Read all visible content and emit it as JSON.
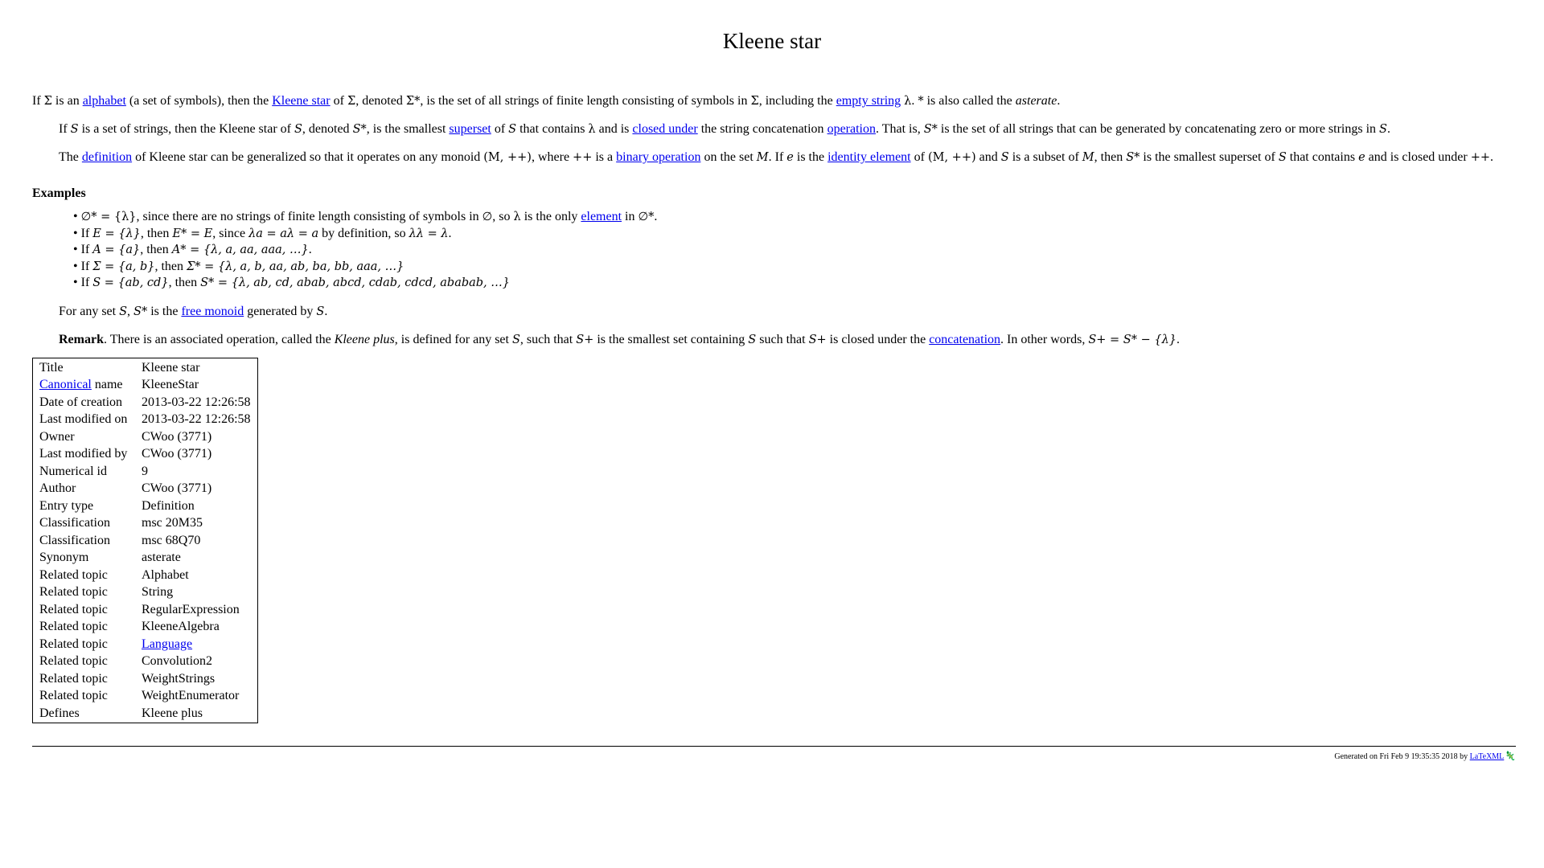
{
  "title": "Kleene star",
  "intro": {
    "t1": "If ",
    "sigma": "Σ",
    "t2": " is an ",
    "link_alphabet": "alphabet",
    "t3": " (a set of symbols), then the ",
    "link_kleene_star": "Kleene star",
    "t4": " of ",
    "sigma2": "Σ",
    "t5": ", denoted ",
    "sigma_star": "Σ*",
    "t6": ", is the set of all strings of finite length consisting of symbols in ",
    "sigma3": "Σ",
    "t7": ", including the ",
    "link_empty_string": "empty string",
    "t8": " ",
    "lambda": "λ",
    "t9": ". ",
    "star": "*",
    "t10": " is also called the ",
    "asterate": "asterate",
    "t11": "."
  },
  "para2": {
    "t1": "If ",
    "S": "S",
    "t2": " is a set of strings, then the Kleene star of ",
    "S2": "S",
    "t3": ", denoted ",
    "S_star": "S*",
    "t4": ", is the smallest ",
    "link_superset": "superset",
    "t5": " of ",
    "S3": "S",
    "t6": " that contains ",
    "lambda": "λ",
    "t7": " and is ",
    "link_closed_under": "closed under",
    "t8": " the string concatenation ",
    "link_operation": "operation",
    "t9": ". That is, ",
    "S_star2": "S*",
    "t10": " is the set of all strings that can be generated by concatenating zero or more strings in ",
    "S4": "S",
    "t11": "."
  },
  "para3": {
    "t1": "The ",
    "link_definition": "definition",
    "t2": " of Kleene star can be generalized so that it operates on any monoid ",
    "monoid": "(M, ++)",
    "t3": ", where ",
    "pp": "++",
    "t4": " is a ",
    "link_binary_operation": "binary operation",
    "t5": " on the set ",
    "M": "M",
    "t6": ". If ",
    "e": "e",
    "t7": " is the ",
    "link_identity_element": "identity element",
    "t8": " of ",
    "monoid2": "(M, ++)",
    "t9": " and ",
    "S": "S",
    "t10": " is a subset of ",
    "M2": "M",
    "t11": ", then ",
    "S_star": "S*",
    "t12": " is the smallest superset of ",
    "S2": "S",
    "t13": " that contains ",
    "e2": "e",
    "t14": " and is closed under ",
    "pp2": "++",
    "t15": "."
  },
  "examples": {
    "heading": "Examples",
    "item1": {
      "m1": "∅* = {λ}",
      "t1": ", since there are no strings of finite length consisting of symbols in ",
      "m2": "∅",
      "t2": ", so ",
      "m3": "λ",
      "t3": " is the only ",
      "link_element": "element",
      "t4": " in ",
      "m4": "∅*",
      "t5": "."
    },
    "item2": {
      "t1": "If ",
      "m1": "E = {λ}",
      "t2": ", then ",
      "m2": "E* = E",
      "t3": ", since ",
      "m3": "λa = aλ = a",
      "t4": " by definition, so ",
      "m4": "λλ = λ",
      "t5": "."
    },
    "item3": {
      "t1": "If ",
      "m1": "A = {a}",
      "t2": ", then ",
      "m2": "A* = {λ, a, aa, aaa, …}",
      "t3": "."
    },
    "item4": {
      "t1": "If ",
      "m1": "Σ = {a, b}",
      "t2": ", then ",
      "m2": "Σ* = {λ, a, b, aa, ab, ba, bb, aaa, …}"
    },
    "item5": {
      "t1": "If ",
      "m1": "S = {ab, cd}",
      "t2": ", then ",
      "m2": "S* = {λ, ab, cd, abab, abcd, cdab, cdcd, ababab, …}"
    }
  },
  "free_monoid_para": {
    "t1": "For any set ",
    "m1": "S",
    "t2": ", ",
    "m2": "S*",
    "t3": " is the ",
    "link_free_monoid": "free monoid",
    "t4": " generated by ",
    "m3": "S",
    "t5": "."
  },
  "remark": {
    "label": "Remark",
    "t1": ". There is an associated operation, called the ",
    "kleene_plus": "Kleene plus",
    "t2": ", is defined for any set ",
    "m1": "S",
    "t3": ", such that ",
    "m2": "S+",
    "t4": " is the smallest set containing ",
    "m3": "S",
    "t5": " such that ",
    "m4": "S+",
    "t6": " is closed under the ",
    "link_concatenation": "concatenation",
    "t7": ". In other words, ",
    "m5": "S+ = S* − {λ}",
    "t8": "."
  },
  "metadata": [
    {
      "key": "Title",
      "value": "Kleene star"
    },
    {
      "key_link": "Canonical",
      "key_rest": " name",
      "value": "KleeneStar"
    },
    {
      "key": "Date of creation",
      "value": "2013-03-22 12:26:58"
    },
    {
      "key": "Last modified on",
      "value": "2013-03-22 12:26:58"
    },
    {
      "key": "Owner",
      "value": "CWoo (3771)"
    },
    {
      "key": "Last modified by",
      "value": "CWoo (3771)"
    },
    {
      "key": "Numerical id",
      "value": "9"
    },
    {
      "key": "Author",
      "value": "CWoo (3771)"
    },
    {
      "key": "Entry type",
      "value": "Definition"
    },
    {
      "key": "Classification",
      "value": "msc 20M35"
    },
    {
      "key": "Classification",
      "value": "msc 68Q70"
    },
    {
      "key": "Synonym",
      "value": "asterate"
    },
    {
      "key": "Related topic",
      "value": "Alphabet"
    },
    {
      "key": "Related topic",
      "value": "String"
    },
    {
      "key": "Related topic",
      "value": "RegularExpression"
    },
    {
      "key": "Related topic",
      "value": "KleeneAlgebra"
    },
    {
      "key": "Related topic",
      "value_link": "Language"
    },
    {
      "key": "Related topic",
      "value": "Convolution2"
    },
    {
      "key": "Related topic",
      "value": "WeightStrings"
    },
    {
      "key": "Related topic",
      "value": "WeightEnumerator"
    },
    {
      "key": "Defines",
      "value": "Kleene plus"
    }
  ],
  "footer": {
    "text": "Generated on Fri Feb 9 19:35:35 2018 by ",
    "link": "LaTeXML",
    "icon": "latexml-mascot-icon"
  },
  "colors": {
    "link": "#0000ee",
    "text": "#000000",
    "background": "#ffffff"
  }
}
